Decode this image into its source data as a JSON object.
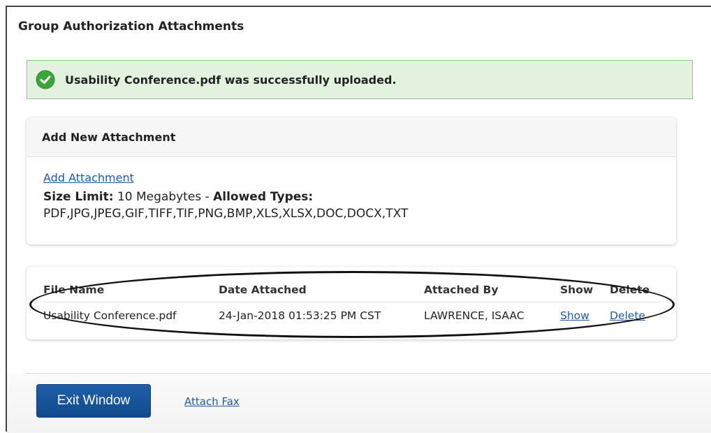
{
  "page": {
    "title": "Group Authorization Attachments"
  },
  "alert": {
    "icon": "check-circle-icon",
    "message": "Usability Conference.pdf was successfully uploaded.",
    "background": "#e2f2df",
    "border": "#8fcc88",
    "icon_color": "#3aa639"
  },
  "add_attachment": {
    "header": "Add New Attachment",
    "link_label": "Add Attachment",
    "size_limit_label": "Size Limit:",
    "size_limit_value": " 10 Megabytes - ",
    "allowed_types_label": "Allowed Types:",
    "allowed_types_value": "PDF,JPG,JPEG,GIF,TIFF,TIF,PNG,BMP,XLS,XLSX,DOC,DOCX,TXT"
  },
  "attachments_table": {
    "columns": [
      "File Name",
      "Date Attached",
      "Attached By",
      "Show",
      "Delete"
    ],
    "rows": [
      {
        "file_name": "Usability Conference.pdf",
        "date_attached": "24-Jan-2018 01:53:25 PM CST",
        "attached_by": "LAWRENCE, ISAAC",
        "show_label": "Show",
        "delete_label": "Delete"
      }
    ]
  },
  "footer": {
    "exit_label": "Exit Window",
    "fax_label": "Attach Fax",
    "button_color": "#1f5fa8",
    "link_color": "#1e5aa8"
  }
}
